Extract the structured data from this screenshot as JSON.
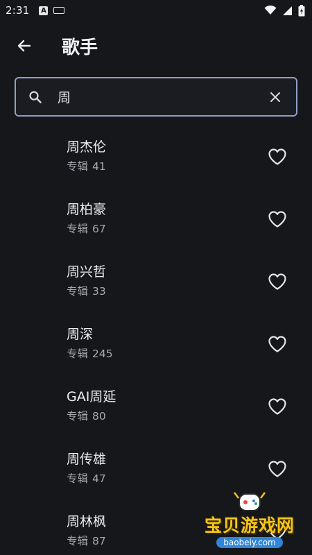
{
  "status_bar": {
    "time": "2:31",
    "icons": [
      "android-a-icon",
      "keyboard-icon",
      "wifi-icon",
      "signal-icon",
      "battery-icon"
    ]
  },
  "header": {
    "title": "歌手",
    "back_icon": "arrow-left-icon"
  },
  "search": {
    "value": "周",
    "icon": "search-icon",
    "clear_icon": "close-icon"
  },
  "artists": [
    {
      "name": "周杰伦",
      "album_label": "专辑",
      "album_count": "41"
    },
    {
      "name": "周柏豪",
      "album_label": "专辑",
      "album_count": "67"
    },
    {
      "name": "周兴哲",
      "album_label": "专辑",
      "album_count": "33"
    },
    {
      "name": "周深",
      "album_label": "专辑",
      "album_count": "245"
    },
    {
      "name": "GAI周延",
      "album_label": "专辑",
      "album_count": "80"
    },
    {
      "name": "周传雄",
      "album_label": "专辑",
      "album_count": "47"
    },
    {
      "name": "周林枫",
      "album_label": "专辑",
      "album_count": "87"
    }
  ],
  "watermark": {
    "title": "宝贝游戏网",
    "url": "baobeiy.com"
  },
  "colors": {
    "background": "#16171b",
    "search_border": "#8fa0c4",
    "primary_text": "#eeeef0",
    "secondary_text": "#a7a8ad",
    "watermark_yellow": "#f4c51a",
    "watermark_blue": "#2f86d8"
  }
}
